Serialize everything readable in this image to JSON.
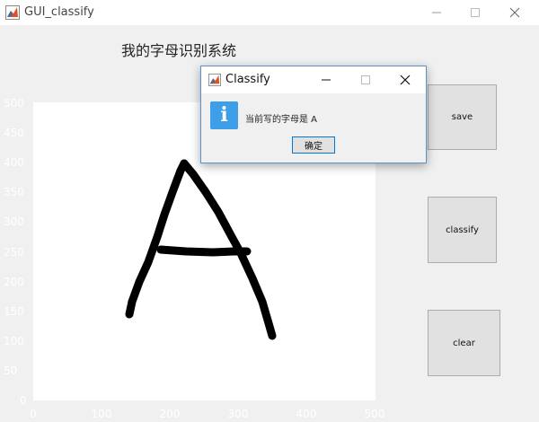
{
  "window": {
    "title": "GUI_classify",
    "icon": "matlab-icon"
  },
  "heading": "我的字母识别系统",
  "axes": {
    "yticks": [
      "500",
      "450",
      "400",
      "350",
      "300",
      "250",
      "200",
      "150",
      "100",
      "50",
      "0"
    ],
    "xticks": [
      "0",
      "100",
      "200",
      "300",
      "400",
      "500"
    ],
    "xlim": [
      0,
      500
    ],
    "ylim": [
      0,
      500
    ],
    "drawn_letter": "A"
  },
  "buttons": {
    "save": "save",
    "classify": "classify",
    "clear": "clear"
  },
  "dialog": {
    "title": "Classify",
    "message": "当前写的字母是 A",
    "ok_label": "确定",
    "icon": "info-icon"
  },
  "colors": {
    "stroke": "#000000",
    "plot_bg": "#ffffff",
    "info_icon": "#3e9fe8"
  }
}
